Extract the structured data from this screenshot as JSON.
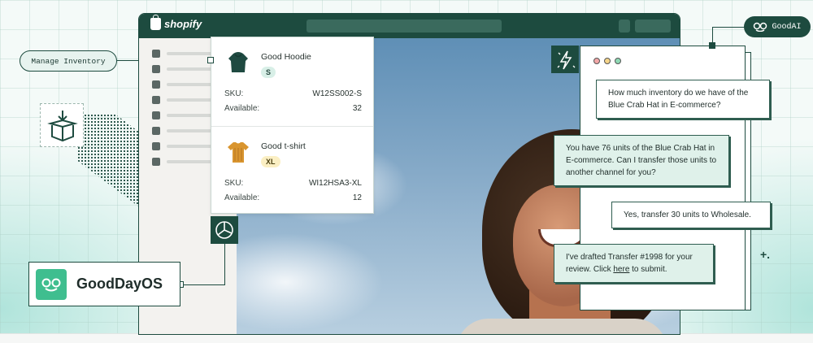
{
  "browser": {
    "logo_text": "shopify"
  },
  "labels": {
    "manage_inventory": "Manage Inventory",
    "goodai": "GoodAI",
    "gooddayos": "GoodDayOS"
  },
  "sidebar": {
    "icons": [
      "home-icon",
      "inbox-icon",
      "tag-icon",
      "person-icon",
      "bank-icon",
      "chart-icon",
      "target-icon",
      "compass-icon"
    ]
  },
  "inventory": {
    "items": [
      {
        "name": "Good Hoodie",
        "size": "S",
        "sku_label": "SKU:",
        "sku": "W12SS002-S",
        "available_label": "Available:",
        "available": "32"
      },
      {
        "name": "Good t-shirt",
        "size": "XL",
        "sku_label": "SKU:",
        "sku": "WI12HSA3-XL",
        "available_label": "Available:",
        "available": "12"
      }
    ]
  },
  "chat": {
    "messages": [
      {
        "role": "user",
        "text": "How much inventory do we have of the Blue Crab Hat in E-commerce?"
      },
      {
        "role": "ai",
        "text": "You have 76 units of the Blue Crab Hat in E-commerce. Can I transfer those units to another channel for you?"
      },
      {
        "role": "user",
        "text": "Yes, transfer 30 units to Wholesale."
      },
      {
        "role": "ai",
        "text_before": "I've drafted Transfer #1998 for your review. Click ",
        "link": "here",
        "text_after": " to submit."
      }
    ],
    "dot_colors": [
      "#f2a7a7",
      "#f5d489",
      "#8fd8b4"
    ]
  },
  "colors": {
    "brand_dark": "#1d4b3f",
    "brand_green": "#3fbe8f",
    "ai_bubble": "#dff1ea"
  }
}
